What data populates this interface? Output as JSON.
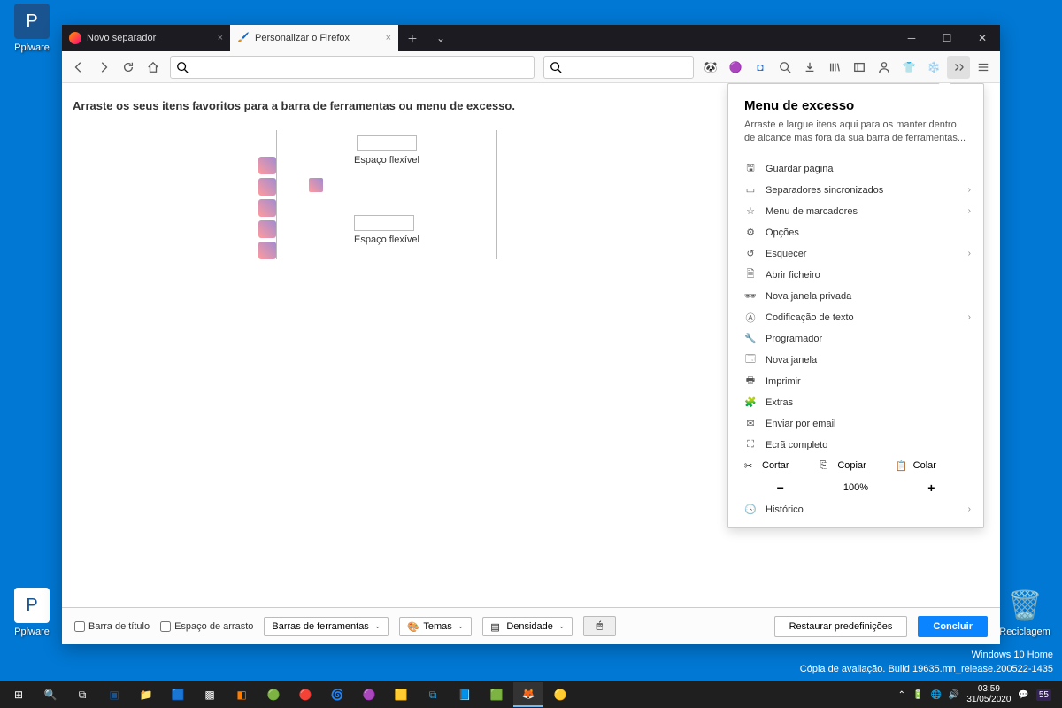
{
  "desktop": {
    "icons": [
      {
        "label": "Pplware"
      },
      {
        "label": "Pplware"
      },
      {
        "label": "Reciclagem"
      }
    ]
  },
  "window": {
    "tabs": [
      {
        "label": "Novo separador"
      },
      {
        "label": "Personalizar o Firefox"
      }
    ]
  },
  "customize": {
    "instruction": "Arraste os seus itens favoritos para a barra de ferramentas ou menu de excesso.",
    "flex_label_1": "Espaço flexível",
    "flex_label_2": "Espaço flexível"
  },
  "overflow": {
    "title": "Menu de excesso",
    "desc": "Arraste e largue itens aqui para os manter dentro de alcance mas fora da sua barra de ferramentas...",
    "items": [
      {
        "label": "Guardar página",
        "chevron": false
      },
      {
        "label": "Separadores sincronizados",
        "chevron": true
      },
      {
        "label": "Menu de marcadores",
        "chevron": true
      },
      {
        "label": "Opções",
        "chevron": false
      },
      {
        "label": "Esquecer",
        "chevron": true
      },
      {
        "label": "Abrir ficheiro",
        "chevron": false
      },
      {
        "label": "Nova janela privada",
        "chevron": false
      },
      {
        "label": "Codificação de texto",
        "chevron": true
      },
      {
        "label": "Programador",
        "chevron": false
      },
      {
        "label": "Nova janela",
        "chevron": false
      },
      {
        "label": "Imprimir",
        "chevron": false
      },
      {
        "label": "Extras",
        "chevron": false
      },
      {
        "label": "Enviar por email",
        "chevron": false
      },
      {
        "label": "Ecrã completo",
        "chevron": false
      }
    ],
    "cut": "Cortar",
    "copy": "Copiar",
    "paste": "Colar",
    "zoom": "100%",
    "history": "Histórico"
  },
  "footer": {
    "title_bar": "Barra de título",
    "drag_space": "Espaço de arrasto",
    "toolbars": "Barras de ferramentas",
    "themes": "Temas",
    "density": "Densidade",
    "restore": "Restaurar predefinições",
    "done": "Concluir"
  },
  "winfo": {
    "edition": "Windows 10 Home",
    "build": "Cópia de avaliação. Build 19635.mn_release.200522-1435"
  },
  "taskbar": {
    "time": "03:59",
    "date": "31/05/2020",
    "notif": "55"
  }
}
